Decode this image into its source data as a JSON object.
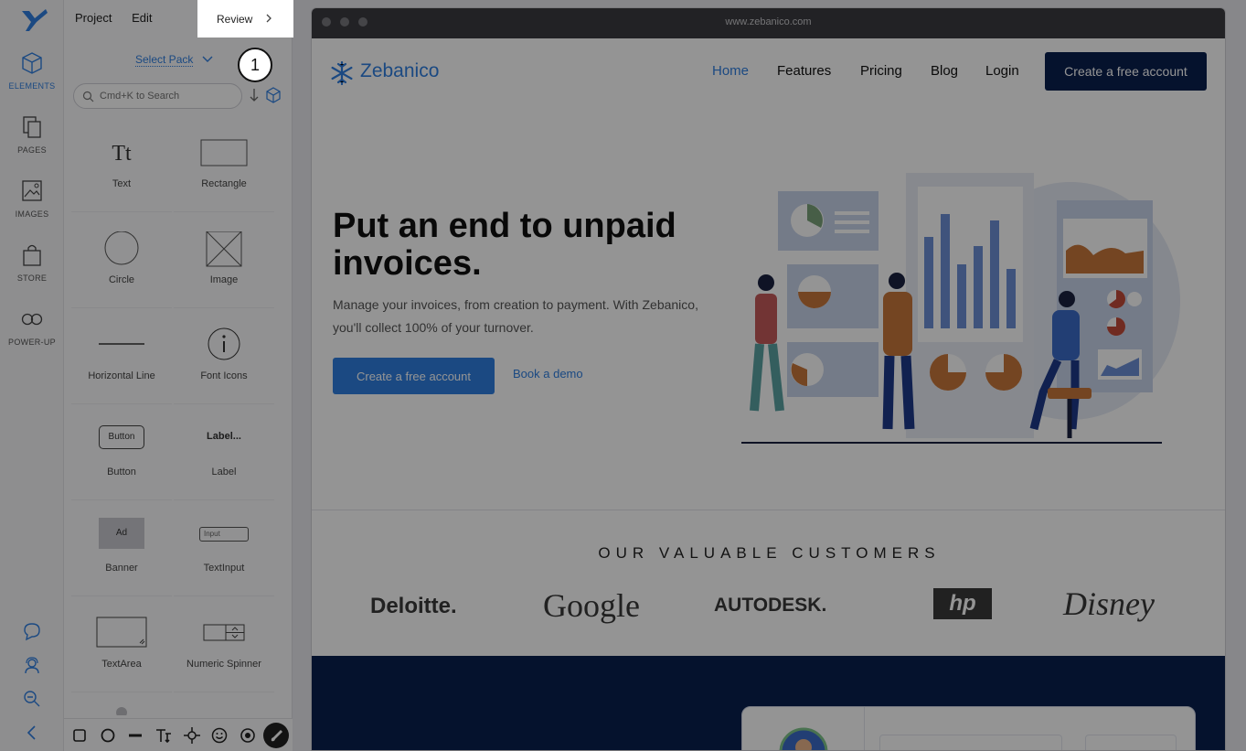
{
  "rail": {
    "items": [
      {
        "label": "ELEMENTS",
        "icon": "cube-icon"
      },
      {
        "label": "PAGES",
        "icon": "pages-icon"
      },
      {
        "label": "IMAGES",
        "icon": "images-icon"
      },
      {
        "label": "STORE",
        "icon": "shopping-bag-icon"
      },
      {
        "label": "POWER-UP",
        "icon": "infinity-icon"
      }
    ],
    "bottom_icons": [
      "chat-icon",
      "user-support-icon",
      "zoom-out-icon",
      "collapse-left-icon"
    ]
  },
  "menu": {
    "project": "Project",
    "edit": "Edit",
    "review": "Review"
  },
  "panel": {
    "select_pack": "Select Pack",
    "search_placeholder": "Cmd+K to Search",
    "elements": [
      "Text",
      "Rectangle",
      "Circle",
      "Image",
      "Horizontal Line",
      "Font Icons",
      "Button",
      "Label",
      "Banner",
      "TextInput",
      "TextArea",
      "Numeric Spinner"
    ],
    "icon_glyphs": {
      "text": "Tt",
      "button": "Button",
      "label": "Label...",
      "banner": "Ad",
      "input": "Input",
      "font_icon": "i"
    }
  },
  "tutorial": {
    "step": "1"
  },
  "browser": {
    "url": "www.zebanico.com",
    "brand": "Zebanico",
    "nav": [
      "Home",
      "Features",
      "Pricing",
      "Blog",
      "Login"
    ],
    "nav_cta": "Create a free account",
    "hero_title": "Put an end to unpaid invoices.",
    "hero_sub": "Manage your invoices, from creation to payment. With Zebanico, you'll collect 100% of your turnover.",
    "hero_button": "Create a free account",
    "hero_link": "Book a demo",
    "customers_title": "OUR VALUABLE CUSTOMERS",
    "customers": [
      "Deloitte.",
      "Google",
      "AUTODESK.",
      "hp",
      "Disney"
    ]
  },
  "colors": {
    "accent": "#2f7fe0",
    "dark": "#0a1f4f"
  }
}
